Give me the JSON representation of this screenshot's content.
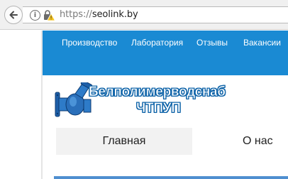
{
  "browser": {
    "url_scheme": "https://",
    "url_host": "seolink.by",
    "icons": [
      "back-arrow-icon",
      "info-icon",
      "warning-lock-icon"
    ]
  },
  "nav": {
    "items": [
      {
        "label": "Производство"
      },
      {
        "label": "Лаборатория"
      },
      {
        "label": "Отзывы"
      },
      {
        "label": "Вакансии"
      }
    ],
    "color": "#1a8ad3"
  },
  "brand": {
    "name": "Белполимерводснаб",
    "sub": "ЧТПУП",
    "text_color": "#ffffff",
    "outline_color": "#0e63a8"
  },
  "menu": {
    "home": "Главная",
    "about": "О нас"
  }
}
